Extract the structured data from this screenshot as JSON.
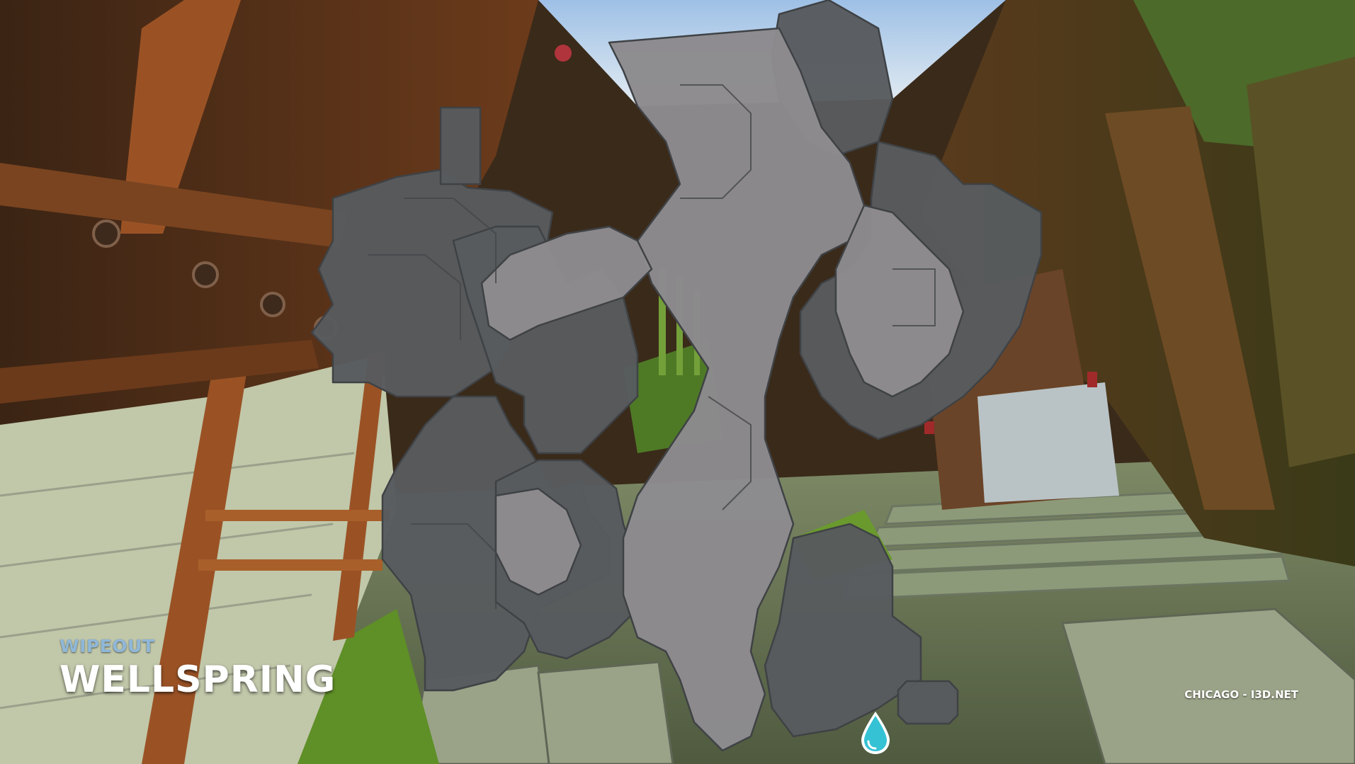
{
  "hud": {
    "mode": "WIPEOUT",
    "map_name": "WELLSPRING",
    "server": "CHICAGO - I3D.NET"
  },
  "minimap": {
    "icon": "water-drop-icon",
    "colors": {
      "dark_region": "#585b5e",
      "light_region": "#8d8b8e",
      "outline": "#3f4245",
      "spawn_marker": "#35c2d4"
    }
  },
  "palette": {
    "sky": "#b8cfe6",
    "wood": "#8a4d23",
    "wood_dark": "#4a2a15",
    "grass": "#5e8a2a",
    "stone": "#9aa58f"
  }
}
